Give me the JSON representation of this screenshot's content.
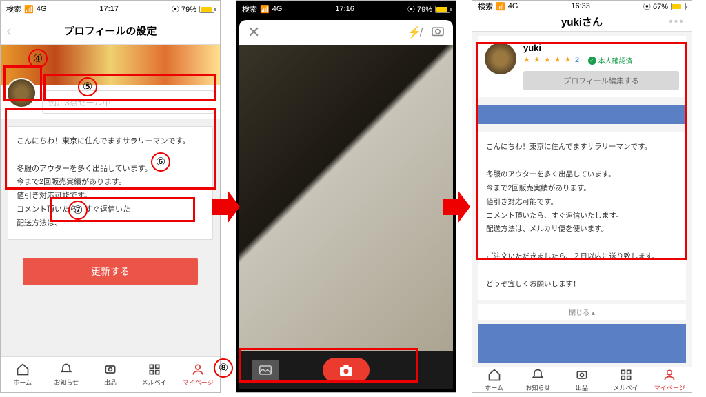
{
  "status": {
    "carrier": "検索",
    "signal": "4G",
    "battery1": "79%",
    "battery3": "67%",
    "time1": "17:17",
    "time2": "17:16",
    "time3": "16:33"
  },
  "screen1": {
    "title": "プロフィールの設定",
    "placeholder": "例）3点セール中",
    "bio": "こんにちわ！東京に住んでますサラリーマンです。\n\n冬服のアウターを多く出品しています。\n今まで2回販売実績があります。\n値引き対応可能です。\nコメント頂いたら、すぐ返信いた\n配送方法は、",
    "button": "更新する"
  },
  "screen3": {
    "title": "yukiさん",
    "name": "yuki",
    "stars": "★ ★ ★ ★ ★",
    "rating_count": "2",
    "verified": "本人確認済",
    "edit": "プロフィール編集する",
    "bio": "こんにちわ！東京に住んでますサラリーマンです。\n\n冬服のアウターを多く出品しています。\n今まで2回販売実績があります。\n値引き対応可能です。\nコメント頂いたら、すぐ返信いたします。\n配送方法は、メルカリ便を使います。\n\nご注文いただきましたら、２日以内に送り致します。\n\nどうぞ宜しくお願いします！",
    "close": "閉じる ▴"
  },
  "nav": {
    "home": "ホーム",
    "notify": "お知らせ",
    "list": "出品",
    "pay": "メルペイ",
    "mypage": "マイページ"
  },
  "annotations": {
    "n4": "④",
    "n5": "⑤",
    "n6": "⑥",
    "n7": "⑦",
    "n8": "⑧"
  }
}
